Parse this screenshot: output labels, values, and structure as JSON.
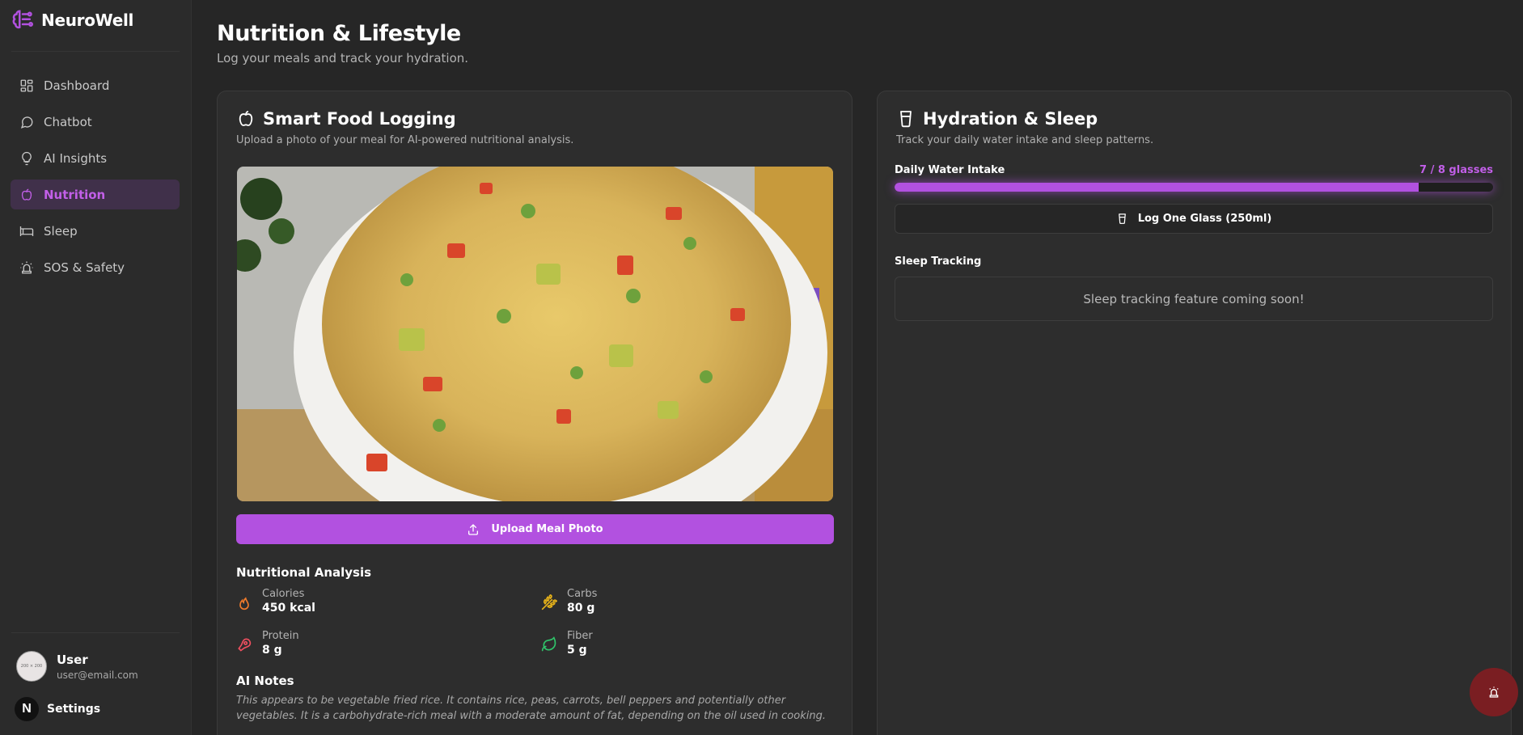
{
  "brand": {
    "name": "NeuroWell",
    "icon": "brain-icon"
  },
  "sidebar": {
    "items": [
      {
        "label": "Dashboard",
        "icon": "grid-icon",
        "active": false
      },
      {
        "label": "Chatbot",
        "icon": "chat-icon",
        "active": false
      },
      {
        "label": "AI Insights",
        "icon": "lightbulb-icon",
        "active": false
      },
      {
        "label": "Nutrition",
        "icon": "apple-icon",
        "active": true
      },
      {
        "label": "Sleep",
        "icon": "bed-icon",
        "active": false
      },
      {
        "label": "SOS & Safety",
        "icon": "siren-icon",
        "active": false
      }
    ],
    "user": {
      "name": "User",
      "email": "user@email.com",
      "avatar_text": "200 × 200"
    },
    "settings": {
      "label": "Settings",
      "badge": "N"
    }
  },
  "header": {
    "title": "Nutrition & Lifestyle",
    "subtitle": "Log your meals and track your hydration."
  },
  "food": {
    "title": "Smart Food Logging",
    "subtitle": "Upload a photo of your meal for AI-powered nutritional analysis.",
    "upload_label": "Upload Meal Photo",
    "analysis_title": "Nutritional Analysis",
    "nutrients": [
      {
        "label": "Calories",
        "value": "450 kcal",
        "icon": "flame-icon",
        "color": "#f07b2c"
      },
      {
        "label": "Carbs",
        "value": "80 g",
        "icon": "wheat-icon",
        "color": "#e8b319"
      },
      {
        "label": "Protein",
        "value": "8 g",
        "icon": "meat-icon",
        "color": "#ef4f5f"
      },
      {
        "label": "Fiber",
        "value": "5 g",
        "icon": "leaf-icon",
        "color": "#2fc46a"
      }
    ],
    "notes_title": "AI Notes",
    "notes": "This appears to be vegetable fried rice. It contains rice, peas, carrots, bell peppers and potentially other vegetables. It is a carbohydrate-rich meal with a moderate amount of fat, depending on the oil used in cooking."
  },
  "hydration": {
    "title": "Hydration & Sleep",
    "subtitle": "Track your daily water intake and sleep patterns.",
    "water_label": "Daily Water Intake",
    "water_count": "7 / 8 glasses",
    "water_progress": 0.875,
    "log_label": "Log One Glass (250ml)",
    "sleep_label": "Sleep Tracking",
    "sleep_message": "Sleep tracking feature coming soon!"
  },
  "colors": {
    "accent": "#b251e0",
    "sos": "#7a1e22"
  }
}
